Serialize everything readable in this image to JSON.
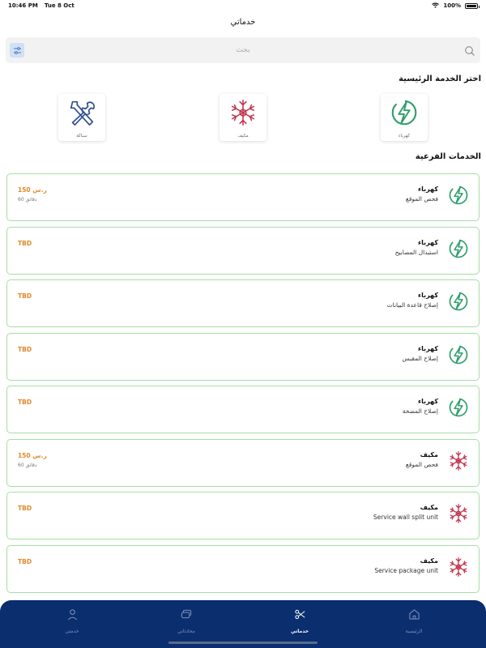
{
  "status_bar": {
    "time": "10:46 PM",
    "date": "Tue 8 Oct",
    "battery_text": "100%",
    "battery_level": 1.0
  },
  "header": {
    "title": "خدماتي"
  },
  "search": {
    "placeholder": "بحث"
  },
  "main_services": {
    "title": "اختر الخدمة الرئيسية",
    "items": [
      {
        "label": "كهرباء",
        "icon": "lightning-icon"
      },
      {
        "label": "مكيف",
        "icon": "snowflake-icon"
      },
      {
        "label": "سباكة",
        "icon": "wrench-icon"
      }
    ]
  },
  "sub_services": {
    "title": "الخدمات الفرعية",
    "items": [
      {
        "category": "كهرباء",
        "name": "فحص الموقع",
        "price": "150 ر.س",
        "duration": "60 دقائق",
        "icon": "lightning-icon"
      },
      {
        "category": "كهرباء",
        "name": "استبدال المصابيح",
        "price": "TBD",
        "duration": "",
        "icon": "lightning-icon"
      },
      {
        "category": "كهرباء",
        "name": "إصلاح قاعدة البيانات",
        "price": "TBD",
        "duration": "",
        "icon": "lightning-icon"
      },
      {
        "category": "كهرباء",
        "name": "إصلاح المقبس",
        "price": "TBD",
        "duration": "",
        "icon": "lightning-icon"
      },
      {
        "category": "كهرباء",
        "name": "إصلاح المضخة",
        "price": "TBD",
        "duration": "",
        "icon": "lightning-icon"
      },
      {
        "category": "مكيف",
        "name": "فحص الموقع",
        "price": "150 ر.س",
        "duration": "60 دقائق",
        "icon": "snowflake-icon"
      },
      {
        "category": "مكيف",
        "name": "Service wall split unit",
        "price": "TBD",
        "duration": "",
        "icon": "snowflake-icon"
      },
      {
        "category": "مكيف",
        "name": "Service package unit",
        "price": "TBD",
        "duration": "",
        "icon": "snowflake-icon"
      }
    ]
  },
  "tab_bar": {
    "items": [
      {
        "label": "خدمتي",
        "icon": "user-icon",
        "active": false
      },
      {
        "label": "محادثاتي",
        "icon": "chat-icon",
        "active": false
      },
      {
        "label": "خدماتي",
        "icon": "scissors-icon",
        "active": true
      },
      {
        "label": "الرئيسية",
        "icon": "home-icon",
        "active": false
      }
    ]
  },
  "colors": {
    "accent_blue": "#0b2e6f",
    "card_border": "#a7dea3",
    "electric_green": "#2e9e6a",
    "ac_red": "#c0304a",
    "price_orange": "#e08a2a"
  }
}
